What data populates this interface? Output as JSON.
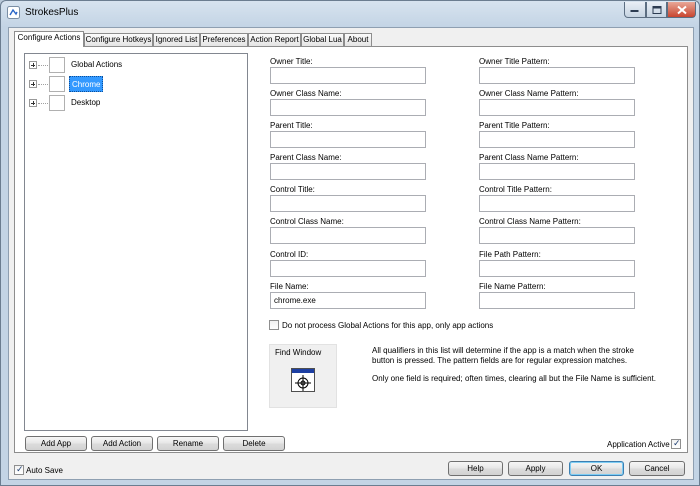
{
  "window": {
    "title": "StrokesPlus"
  },
  "tabs": [
    {
      "label": "Configure Actions"
    },
    {
      "label": "Configure Hotkeys"
    },
    {
      "label": "Ignored List"
    },
    {
      "label": "Preferences"
    },
    {
      "label": "Action Report"
    },
    {
      "label": "Global Lua"
    },
    {
      "label": "About"
    }
  ],
  "tree": {
    "items": [
      {
        "label": "Global Actions"
      },
      {
        "label": "Chrome"
      },
      {
        "label": "Desktop"
      }
    ]
  },
  "fields": {
    "owner_title": {
      "label": "Owner Title:",
      "value": ""
    },
    "owner_title_pattern": {
      "label": "Owner Title Pattern:",
      "value": ""
    },
    "owner_class_name": {
      "label": "Owner Class Name:",
      "value": ""
    },
    "owner_class_name_pattern": {
      "label": "Owner Class Name Pattern:",
      "value": ""
    },
    "parent_title": {
      "label": "Parent Title:",
      "value": ""
    },
    "parent_title_pattern": {
      "label": "Parent Title Pattern:",
      "value": ""
    },
    "parent_class_name": {
      "label": "Parent Class Name:",
      "value": ""
    },
    "parent_class_name_pattern": {
      "label": "Parent Class Name Pattern:",
      "value": ""
    },
    "control_title": {
      "label": "Control Title:",
      "value": ""
    },
    "control_title_pattern": {
      "label": "Control Title Pattern:",
      "value": ""
    },
    "control_class_name": {
      "label": "Control Class Name:",
      "value": ""
    },
    "control_class_name_pattern": {
      "label": "Control Class Name Pattern:",
      "value": ""
    },
    "control_id": {
      "label": "Control ID:",
      "value": ""
    },
    "file_path_pattern": {
      "label": "File Path Pattern:",
      "value": ""
    },
    "file_name": {
      "label": "File Name:",
      "value": "chrome.exe"
    },
    "file_name_pattern": {
      "label": "File Name Pattern:",
      "value": ""
    }
  },
  "options": {
    "no_global_actions": "Do not process Global Actions for this app, only app actions",
    "application_active": "Application Active",
    "auto_save": "Auto Save"
  },
  "find_window": {
    "title": "Find Window"
  },
  "info": {
    "line1": "All qualifiers in this list will determine if the app is a match when the stroke button is pressed. The pattern fields are for regular expression matches.",
    "line2": "Only one field is required; often times, clearing all but the File Name is sufficient."
  },
  "buttons": {
    "add_app": "Add App",
    "add_action": "Add Action",
    "rename": "Rename",
    "delete": "Delete",
    "help": "Help",
    "apply": "Apply",
    "ok": "OK",
    "cancel": "Cancel"
  },
  "colors": {
    "selection": "#3399ff",
    "title_bar": "#c3d4e5",
    "close_button": "#c9452f"
  }
}
